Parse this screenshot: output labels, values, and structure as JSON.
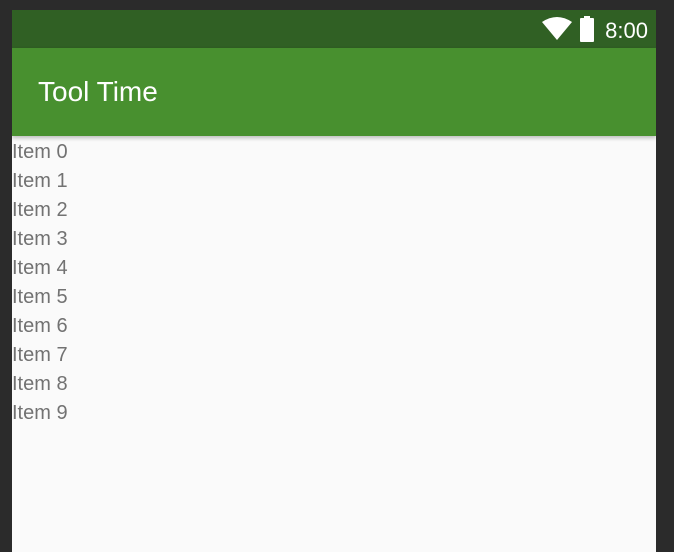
{
  "status_bar": {
    "time": "8:00",
    "icons": [
      "wifi-icon",
      "battery-icon"
    ]
  },
  "app_bar": {
    "title": "Tool Time"
  },
  "list": {
    "items": [
      "Item 0",
      "Item 1",
      "Item 2",
      "Item 3",
      "Item 4",
      "Item 5",
      "Item 6",
      "Item 7",
      "Item 8",
      "Item 9"
    ]
  },
  "colors": {
    "status_bar": "#306024",
    "app_bar": "#48902f",
    "background": "#fafafa",
    "item_text": "#727272",
    "frame": "#2b2b2b"
  }
}
